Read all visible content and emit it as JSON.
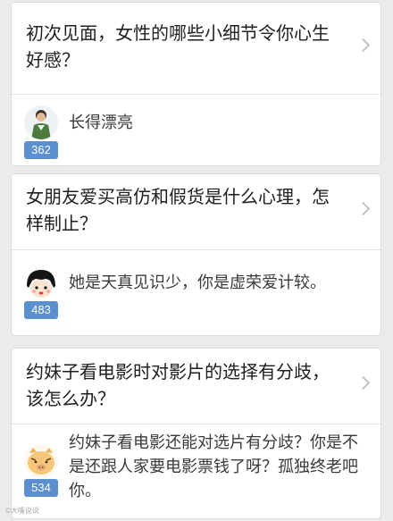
{
  "feed": {
    "items": [
      {
        "question": "初次见面，女性的哪些小细节令你心生好感？",
        "answer": "长得漂亮",
        "votes": "362",
        "avatar_icon": "man-photo-avatar-icon"
      },
      {
        "question": "女朋友爱买高仿和假货是什么心理，怎样制止？",
        "answer": "她是天真见识少，你是虚荣爱计较。",
        "votes": "483",
        "avatar_icon": "cartoon-girl-avatar-icon"
      },
      {
        "question": "约妹子看电影时对影片的选择有分歧，该怎么办？",
        "answer": "约妹子看电影还能对选片有分歧？你是不是还跟人家要电影票钱了呀？孤独终老吧你。",
        "votes": "534",
        "avatar_icon": "cartoon-pig-avatar-icon"
      }
    ]
  },
  "watermark": {
    "text": "©大嘴说说"
  },
  "colors": {
    "background": "#ebebeb",
    "card": "#ffffff",
    "vote_badge": "#5b8fd0",
    "chevron": "#c2c2c2"
  }
}
